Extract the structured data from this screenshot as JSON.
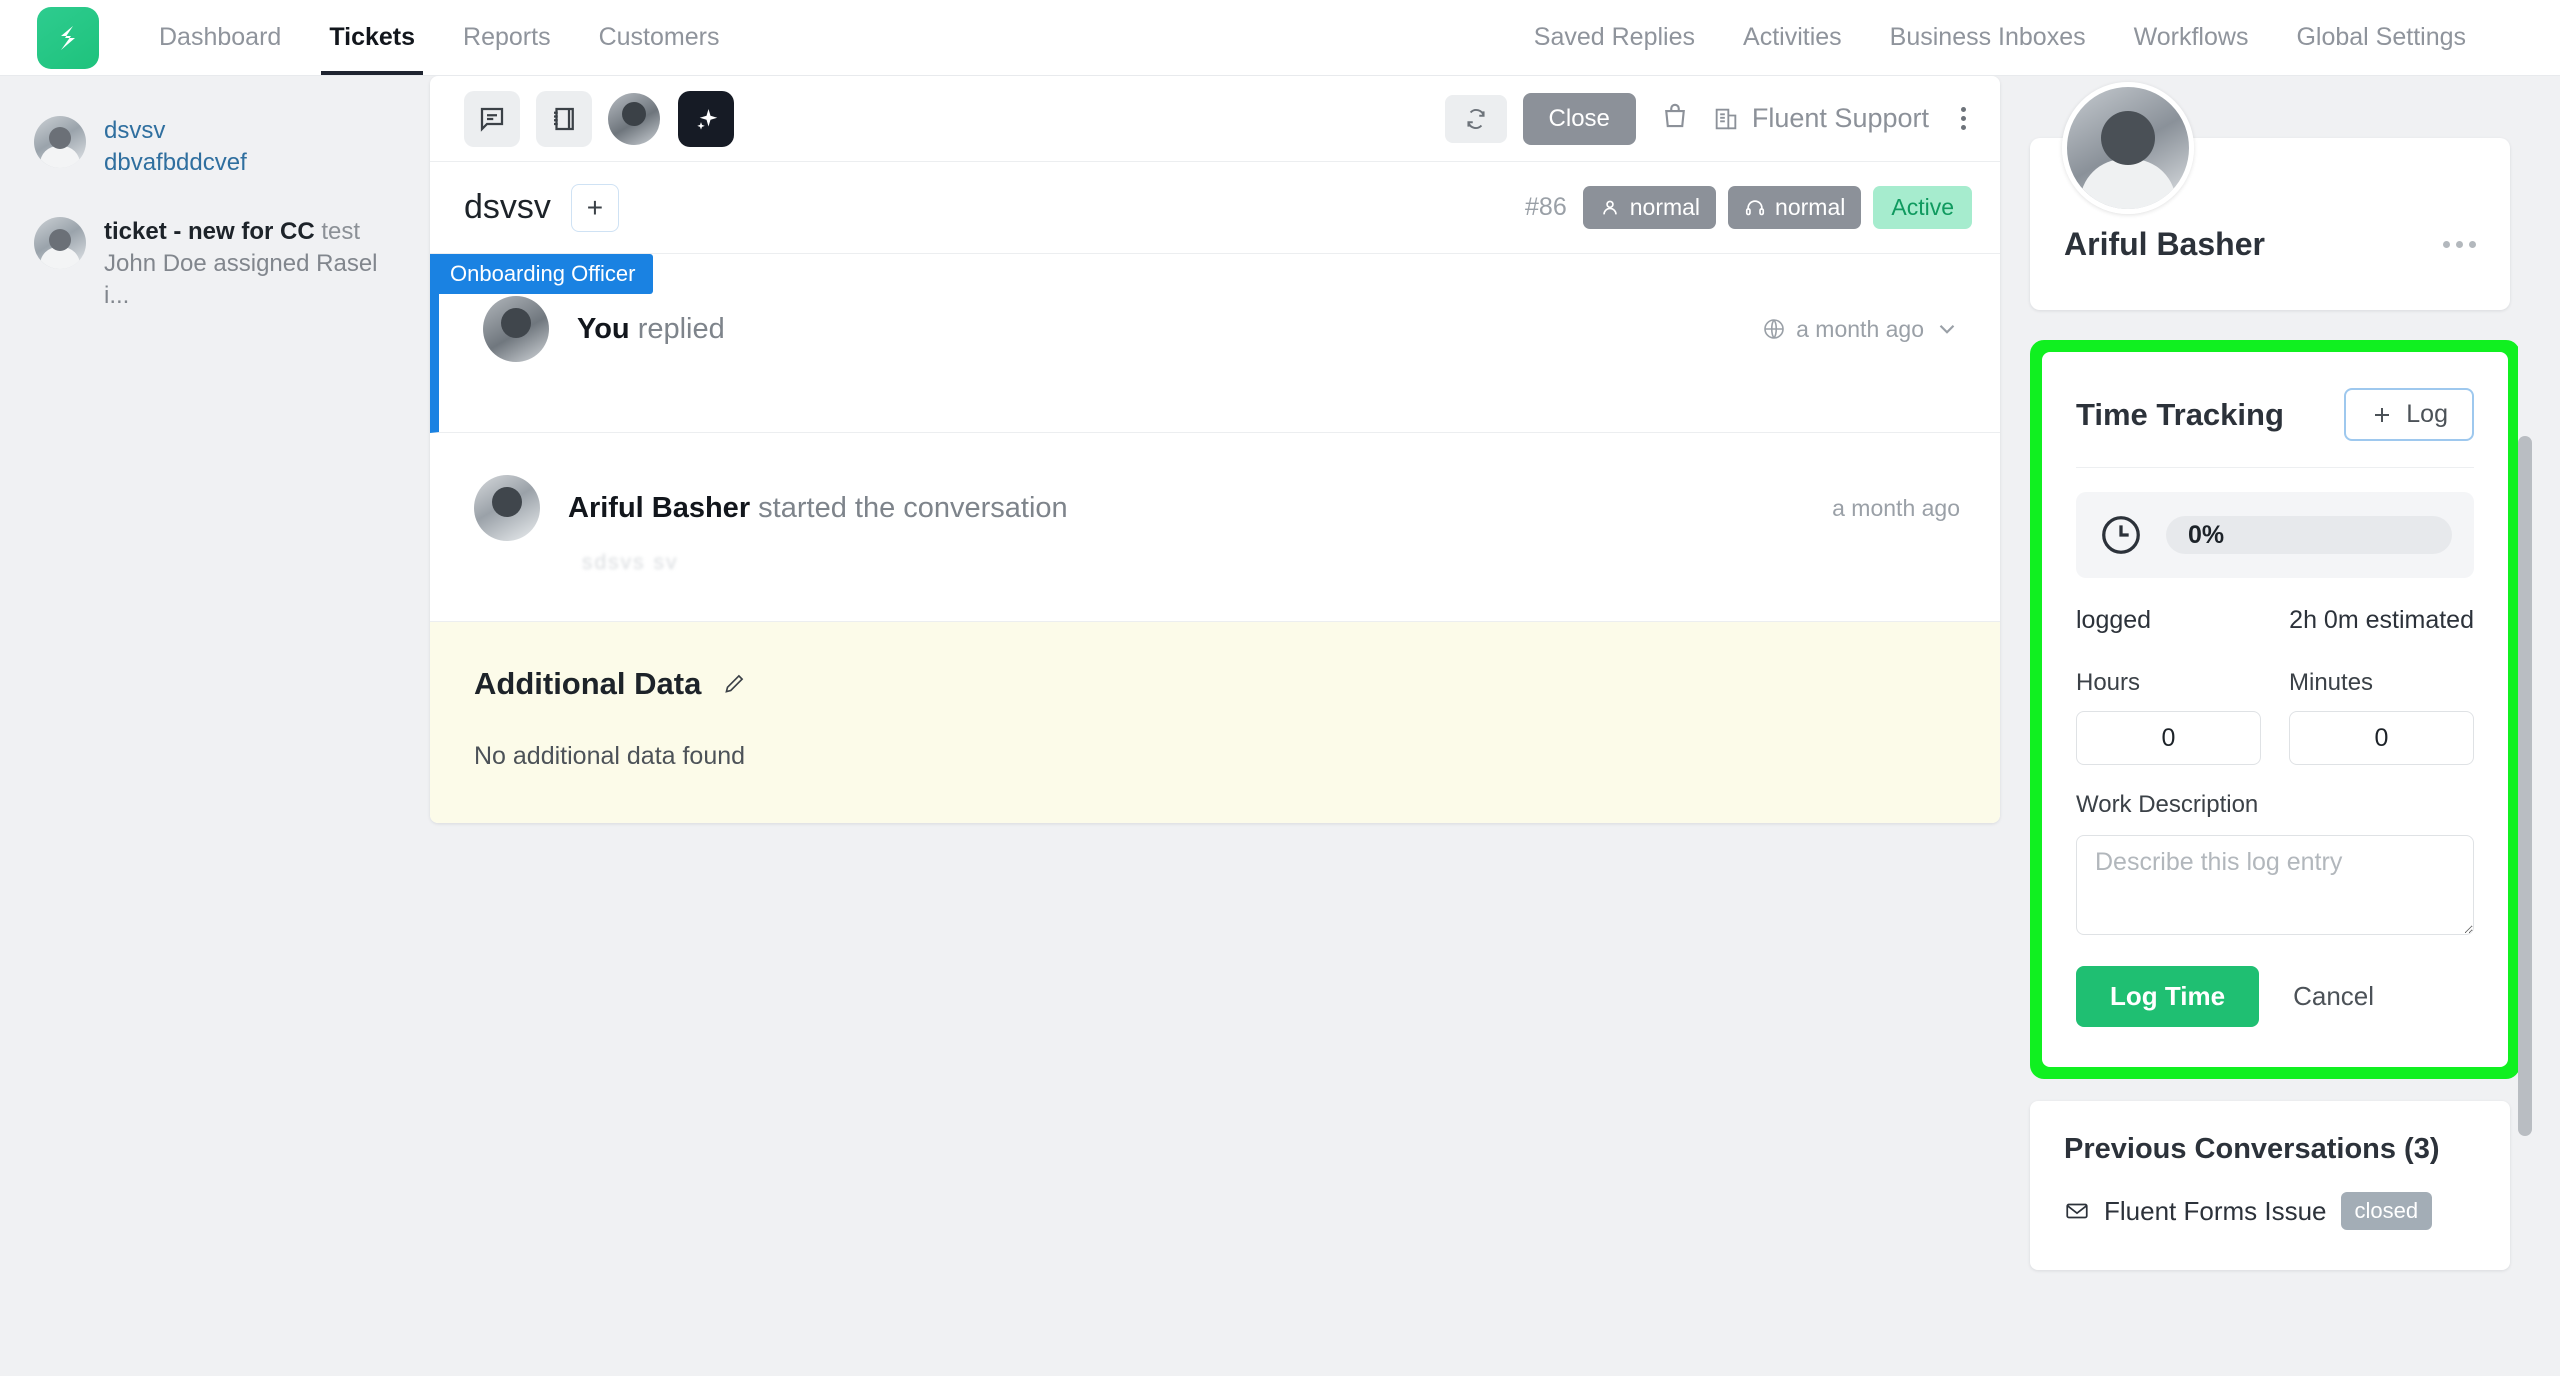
{
  "nav": {
    "logo_icon": "fluent-support-logo",
    "left_items": [
      {
        "label": "Dashboard",
        "active": false
      },
      {
        "label": "Tickets",
        "active": true
      },
      {
        "label": "Reports",
        "active": false
      },
      {
        "label": "Customers",
        "active": false
      }
    ],
    "right_items": [
      {
        "label": "Saved Replies"
      },
      {
        "label": "Activities"
      },
      {
        "label": "Business Inboxes"
      },
      {
        "label": "Workflows"
      },
      {
        "label": "Global Settings"
      }
    ]
  },
  "sidebar": {
    "conversations": [
      {
        "title": "dsvsv",
        "subtitle": "dbvafbddcvef",
        "style": "link"
      },
      {
        "title": "ticket - new for CC",
        "title_muted": " test",
        "subtitle": "John Doe assigned Rasel i...",
        "style": "dark"
      }
    ]
  },
  "toolbar": {
    "comment_icon": "comment-icon",
    "notes_icon": "notes-icon",
    "agent_avatar": "agent-avatar",
    "ai_icon": "ai-sparkle-icon",
    "refresh_icon": "refresh-icon",
    "close_label": "Close",
    "bag_icon": "shopping-bag-icon",
    "inbox_icon": "building-icon",
    "inbox_name": "Fluent Support",
    "kebab_icon": "more-options-icon"
  },
  "ticket": {
    "title": "dsvsv",
    "add_label": "+",
    "id": "#86",
    "chips": [
      {
        "label": "normal",
        "icon": "user-icon",
        "kind": "grey"
      },
      {
        "label": "normal",
        "icon": "headset-icon",
        "kind": "grey"
      },
      {
        "label": "Active",
        "icon": "",
        "kind": "active"
      }
    ]
  },
  "thread": {
    "messages": [
      {
        "role_tag": "Onboarding Officer",
        "author": "You",
        "action": "replied",
        "time": "a month ago",
        "has_globe_icon": true,
        "has_chevron": true,
        "body": ""
      },
      {
        "role_tag": "",
        "author": "Ariful Basher",
        "action": "started the conversation",
        "time": "a month ago",
        "has_globe_icon": false,
        "has_chevron": false,
        "body": "sdsvs  sv"
      }
    ]
  },
  "additional_data": {
    "title": "Additional Data",
    "edit_icon": "pencil-icon",
    "empty_text": "No additional data found"
  },
  "profile": {
    "avatar": "customer-avatar",
    "name": "Ariful Basher",
    "menu_icon": "more-options-icon"
  },
  "time_tracking": {
    "title": "Time Tracking",
    "log_button": "Log",
    "log_plus_icon": "plus-icon",
    "clock_icon": "clock-icon",
    "progress_percent": "0%",
    "progress_value": 0,
    "logged_label": "logged",
    "estimated_label": "2h 0m estimated",
    "hours_label": "Hours",
    "hours_value": "0",
    "minutes_label": "Minutes",
    "minutes_value": "0",
    "description_label": "Work Description",
    "description_value": "",
    "description_placeholder": "Describe this log entry",
    "submit_label": "Log Time",
    "cancel_label": "Cancel",
    "highlight_color": "#10f020",
    "accent_color": "#1fbf72"
  },
  "previous_conversations": {
    "title": "Previous Conversations (3)",
    "items": [
      {
        "mail_icon": "envelope-icon",
        "label": "Fluent Forms Issue",
        "status": "closed"
      }
    ]
  }
}
